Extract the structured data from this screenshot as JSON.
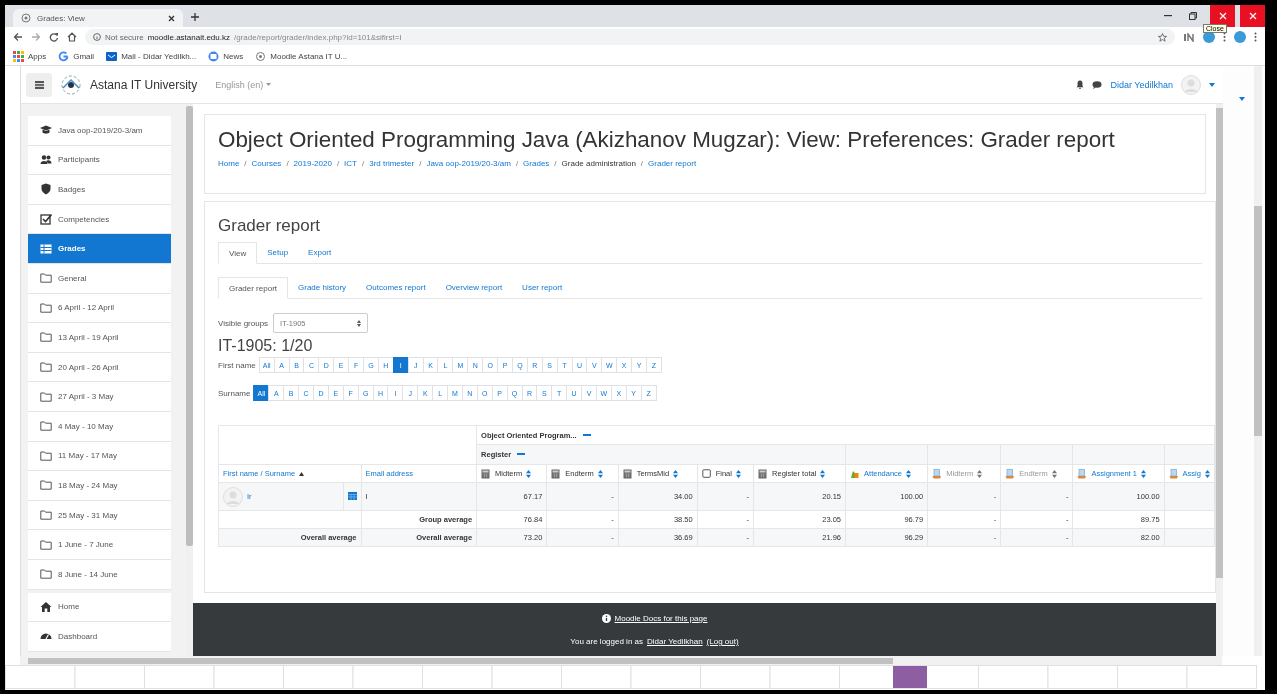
{
  "browser": {
    "tab_title": "Grades: View",
    "tooltip": "Close",
    "security": "Not secure",
    "url_host": "moodle.astanait.edu.kz",
    "url_path": "/grade/report/grader/index.php?id=101&sifirst=I",
    "bookmarks": [
      {
        "label": "Apps",
        "kind": "apps"
      },
      {
        "label": "Gmail",
        "kind": "google"
      },
      {
        "label": "Mail - Didar Yedilkh...",
        "kind": "mail"
      },
      {
        "label": "News",
        "kind": "news"
      },
      {
        "label": "Moodle Astana IT U...",
        "kind": "moodle"
      }
    ]
  },
  "navbar": {
    "site_name": "Astana IT University",
    "language": "English (en)",
    "user_name": "Didar Yedilkhan"
  },
  "drawer": {
    "course_nav": [
      {
        "label": "Java oop-2019/20-3/am",
        "kind": "course",
        "selected": false
      },
      {
        "label": "Participants",
        "kind": "participants",
        "selected": false
      },
      {
        "label": "Badges",
        "kind": "badge",
        "selected": false
      },
      {
        "label": "Competencies",
        "kind": "competency",
        "selected": false
      },
      {
        "label": "Grades",
        "kind": "grades",
        "selected": true
      },
      {
        "label": "General",
        "kind": "section",
        "selected": false
      },
      {
        "label": "6 April - 12 April",
        "kind": "section",
        "selected": false
      },
      {
        "label": "13 April - 19 April",
        "kind": "section",
        "selected": false
      },
      {
        "label": "20 April - 26 April",
        "kind": "section",
        "selected": false
      },
      {
        "label": "27 April - 3 May",
        "kind": "section",
        "selected": false
      },
      {
        "label": "4 May - 10 May",
        "kind": "section",
        "selected": false
      },
      {
        "label": "11 May - 17 May",
        "kind": "section",
        "selected": false
      },
      {
        "label": "18 May - 24 May",
        "kind": "section",
        "selected": false
      },
      {
        "label": "25 May - 31 May",
        "kind": "section",
        "selected": false
      },
      {
        "label": "1 June - 7 June",
        "kind": "section",
        "selected": false
      },
      {
        "label": "8 June - 14 June",
        "kind": "section",
        "selected": false
      }
    ],
    "site_nav": [
      {
        "label": "Home",
        "kind": "home",
        "selected": false
      },
      {
        "label": "Dashboard",
        "kind": "dashboard",
        "selected": false
      }
    ]
  },
  "page_header": {
    "title": "Object Oriented Programming Java (Akizhanov Mugzar): View: Preferences: Grader report",
    "breadcrumbs": [
      {
        "label": "Home",
        "link": true,
        "separator": "/"
      },
      {
        "label": "Courses",
        "link": true,
        "separator": "/"
      },
      {
        "label": "2019-2020",
        "link": true,
        "separator": "/"
      },
      {
        "label": "ICT",
        "link": true,
        "separator": "/"
      },
      {
        "label": "3rd trimester",
        "link": true,
        "separator": "/"
      },
      {
        "label": "Java oop-2019/20-3/am",
        "link": true,
        "separator": "/"
      },
      {
        "label": "Grades",
        "link": true,
        "separator": "/"
      },
      {
        "label": "Grade administration",
        "link": false,
        "separator": "/"
      },
      {
        "label": "Grader report",
        "link": true
      }
    ]
  },
  "report": {
    "heading": "Grader report",
    "tabs": [
      {
        "label": "View",
        "selected": true
      },
      {
        "label": "Setup",
        "selected": false
      },
      {
        "label": "Export",
        "selected": false
      }
    ],
    "subtabs": [
      {
        "label": "Grader report",
        "selected": true
      },
      {
        "label": "Grade history",
        "selected": false
      },
      {
        "label": "Outcomes report",
        "selected": false
      },
      {
        "label": "Overview report",
        "selected": false
      },
      {
        "label": "User report",
        "selected": false
      }
    ],
    "visible_groups": {
      "label": "Visible groups",
      "value": "IT-1905"
    },
    "group_count": "IT-1905: 1/20",
    "first_name_filter": {
      "label": "First name",
      "letters": [
        {
          "label": "All",
          "selected": false
        },
        {
          "label": "A",
          "selected": false
        },
        {
          "label": "B",
          "selected": false
        },
        {
          "label": "C",
          "selected": false
        },
        {
          "label": "D",
          "selected": false
        },
        {
          "label": "E",
          "selected": false
        },
        {
          "label": "F",
          "selected": false
        },
        {
          "label": "G",
          "selected": false
        },
        {
          "label": "H",
          "selected": false
        },
        {
          "label": "I",
          "selected": true
        },
        {
          "label": "J",
          "selected": false
        },
        {
          "label": "K",
          "selected": false
        },
        {
          "label": "L",
          "selected": false
        },
        {
          "label": "M",
          "selected": false
        },
        {
          "label": "N",
          "selected": false
        },
        {
          "label": "O",
          "selected": false
        },
        {
          "label": "P",
          "selected": false
        },
        {
          "label": "Q",
          "selected": false
        },
        {
          "label": "R",
          "selected": false
        },
        {
          "label": "S",
          "selected": false
        },
        {
          "label": "T",
          "selected": false
        },
        {
          "label": "U",
          "selected": false
        },
        {
          "label": "V",
          "selected": false
        },
        {
          "label": "W",
          "selected": false
        },
        {
          "label": "X",
          "selected": false
        },
        {
          "label": "Y",
          "selected": false
        },
        {
          "label": "Z",
          "selected": false
        }
      ]
    },
    "surname_filter": {
      "label": "Surname",
      "letters": [
        {
          "label": "All",
          "selected": true
        },
        {
          "label": "A",
          "selected": false
        },
        {
          "label": "B",
          "selected": false
        },
        {
          "label": "C",
          "selected": false
        },
        {
          "label": "D",
          "selected": false
        },
        {
          "label": "E",
          "selected": false
        },
        {
          "label": "F",
          "selected": false
        },
        {
          "label": "G",
          "selected": false
        },
        {
          "label": "H",
          "selected": false
        },
        {
          "label": "I",
          "selected": false
        },
        {
          "label": "J",
          "selected": false
        },
        {
          "label": "K",
          "selected": false
        },
        {
          "label": "L",
          "selected": false
        },
        {
          "label": "M",
          "selected": false
        },
        {
          "label": "N",
          "selected": false
        },
        {
          "label": "O",
          "selected": false
        },
        {
          "label": "P",
          "selected": false
        },
        {
          "label": "Q",
          "selected": false
        },
        {
          "label": "R",
          "selected": false
        },
        {
          "label": "S",
          "selected": false
        },
        {
          "label": "T",
          "selected": false
        },
        {
          "label": "U",
          "selected": false
        },
        {
          "label": "V",
          "selected": false
        },
        {
          "label": "W",
          "selected": false
        },
        {
          "label": "X",
          "selected": false
        },
        {
          "label": "Y",
          "selected": false
        },
        {
          "label": "Z",
          "selected": false
        }
      ]
    },
    "table": {
      "category": "Object Oriented Program...",
      "name_column": "First name / Surname",
      "email_column": "Email address",
      "register": {
        "label": "Register",
        "columns": [
          {
            "label": "Midterm",
            "kind": "calc",
            "link": false,
            "dimmed": false
          },
          {
            "label": "Endterm",
            "kind": "calc",
            "link": false,
            "dimmed": false
          },
          {
            "label": "TermsMid",
            "kind": "calc",
            "link": false,
            "dimmed": false
          },
          {
            "label": "Final",
            "kind": "manual",
            "link": false,
            "dimmed": false
          },
          {
            "label": "Register total",
            "kind": "calc",
            "link": false,
            "dimmed": false
          }
        ]
      },
      "other_columns": [
        {
          "label": "Attendance",
          "kind": "attendance",
          "link": true,
          "dimmed": false
        },
        {
          "label": "Midterm",
          "kind": "assign",
          "link": false,
          "dimmed": true
        },
        {
          "label": "Endterm",
          "kind": "assign",
          "link": false,
          "dimmed": true
        },
        {
          "label": "Assignment 1",
          "kind": "assign",
          "link": true,
          "dimmed": false
        },
        {
          "label": "Assig",
          "kind": "assign",
          "link": true,
          "dimmed": false
        }
      ],
      "student": {
        "name": "Ir",
        "email": "I",
        "grades": [
          "67.17",
          "-",
          "34.00",
          "-",
          "20.15",
          "100.00",
          "-",
          "-",
          "100.00"
        ]
      },
      "averages": [
        {
          "label": "Group average",
          "values": [
            "76.84",
            "-",
            "38.50",
            "-",
            "23.05",
            "96.79",
            "-",
            "-",
            "89.75"
          ]
        },
        {
          "name_cell": "Overall average",
          "label": "Overall average",
          "values": [
            "73.20",
            "-",
            "36.69",
            "-",
            "21.96",
            "96.29",
            "-",
            "-",
            "82.00"
          ]
        }
      ]
    }
  },
  "footer": {
    "docs_link": "Moodle Docs for this page",
    "login_prefix": "You are logged in as",
    "login_user": "Didar Yedilkhan",
    "logout": "(Log out)"
  }
}
